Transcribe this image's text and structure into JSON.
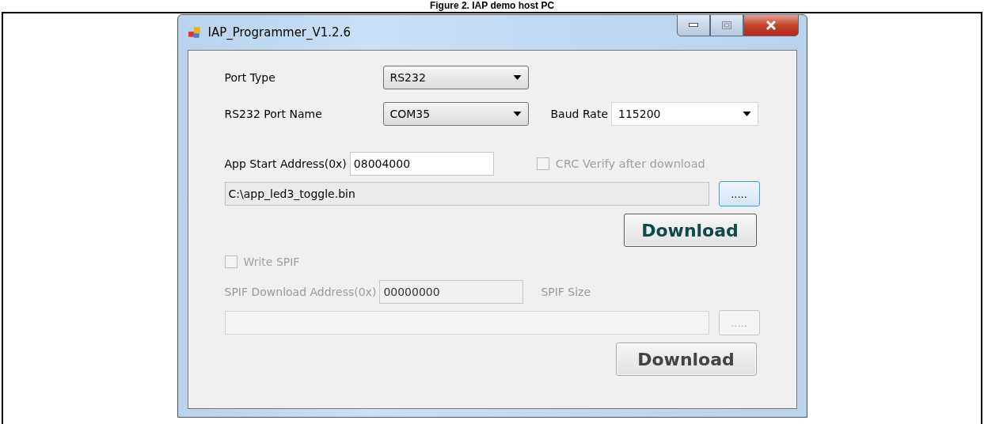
{
  "caption": "Figure 2. IAP demo host PC",
  "window": {
    "title": "IAP_Programmer_V1.2.6"
  },
  "port_type": {
    "label": "Port Type",
    "value": "RS232"
  },
  "port_name": {
    "label": "RS232 Port Name",
    "value": "COM35"
  },
  "baud_rate": {
    "label": "Baud Rate",
    "value": "115200"
  },
  "app_address": {
    "label": "App Start Address(0x)",
    "value": "08004000"
  },
  "crc_verify": {
    "label": "CRC Verify after download",
    "checked": false,
    "disabled": true
  },
  "app_file": {
    "value": "C:\\app_led3_toggle.bin",
    "browse": ".....",
    "disabled": false
  },
  "app_download": {
    "label": "Download",
    "disabled": false
  },
  "write_spif": {
    "label": "Write SPIF",
    "checked": false,
    "disabled": true
  },
  "spif_address": {
    "label": "SPIF Download Address(0x)",
    "value": "00000000",
    "disabled": true
  },
  "spif_size": {
    "label": "SPIF Size",
    "disabled": true
  },
  "spif_file": {
    "browse": ".....",
    "disabled": true
  },
  "spif_download": {
    "label": "Download",
    "disabled": true
  }
}
